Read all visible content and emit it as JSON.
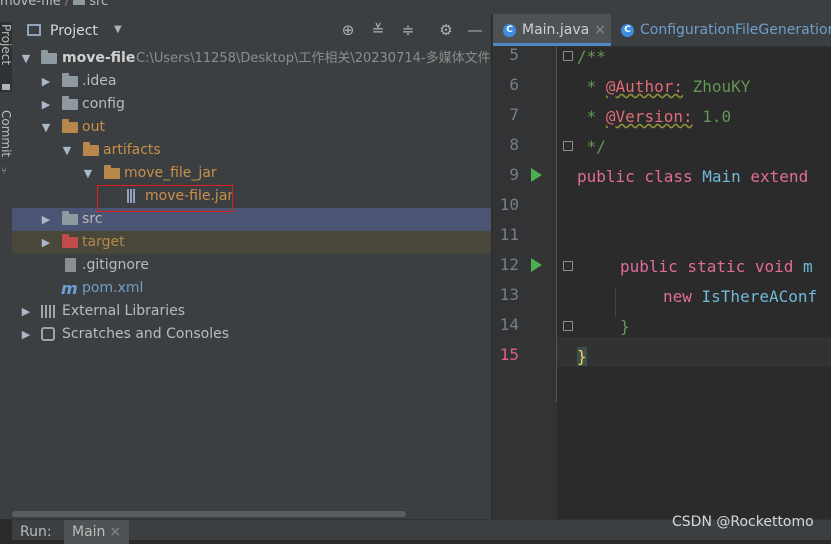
{
  "breadcrumb": {
    "project": "move-file",
    "folder": "src"
  },
  "stripe": {
    "project_label": "Project",
    "commit_label": "Commit"
  },
  "project_panel": {
    "title": "Project",
    "tree": [
      {
        "label": "move-file",
        "path": "C:\\Users\\11258\\Desktop\\工作相关\\20230714-多媒体文件"
      },
      {
        "label": ".idea"
      },
      {
        "label": "config"
      },
      {
        "label": "out"
      },
      {
        "label": "artifacts"
      },
      {
        "label": "move_file_jar"
      },
      {
        "label": "move-file.jar"
      },
      {
        "label": "src"
      },
      {
        "label": "target"
      },
      {
        "label": ".gitignore"
      },
      {
        "label": "pom.xml"
      },
      {
        "label": "External Libraries"
      },
      {
        "label": "Scratches and Consoles"
      }
    ]
  },
  "editor": {
    "tabs": [
      {
        "label": "Main.java",
        "icon": "C"
      },
      {
        "label": "ConfigurationFileGeneration.",
        "icon": "C"
      }
    ],
    "line_numbers": [
      "5",
      "6",
      "7",
      "8",
      "9",
      "10",
      "11",
      "12",
      "13",
      "14",
      "15"
    ],
    "code": {
      "l5": "/**",
      "l6_star": " * ",
      "l6_tag": "@Author:",
      "l6_val": " ZhouKY",
      "l7_star": " * ",
      "l7_tag": "@Version:",
      "l7_val": " 1.0",
      "l8": " */",
      "l9_kw": "public class ",
      "l9_cls": "Main",
      "l9_rest": " extend",
      "l12_kw": "public static void ",
      "l12_fn": "m",
      "l13_kw": "new ",
      "l13_cls": "IsThereAConf",
      "l14": "}",
      "l15": "}"
    }
  },
  "bottom_bar": {
    "run_label": "Run:",
    "tab_label": "Main"
  },
  "watermark": "CSDN @Rockettomo"
}
